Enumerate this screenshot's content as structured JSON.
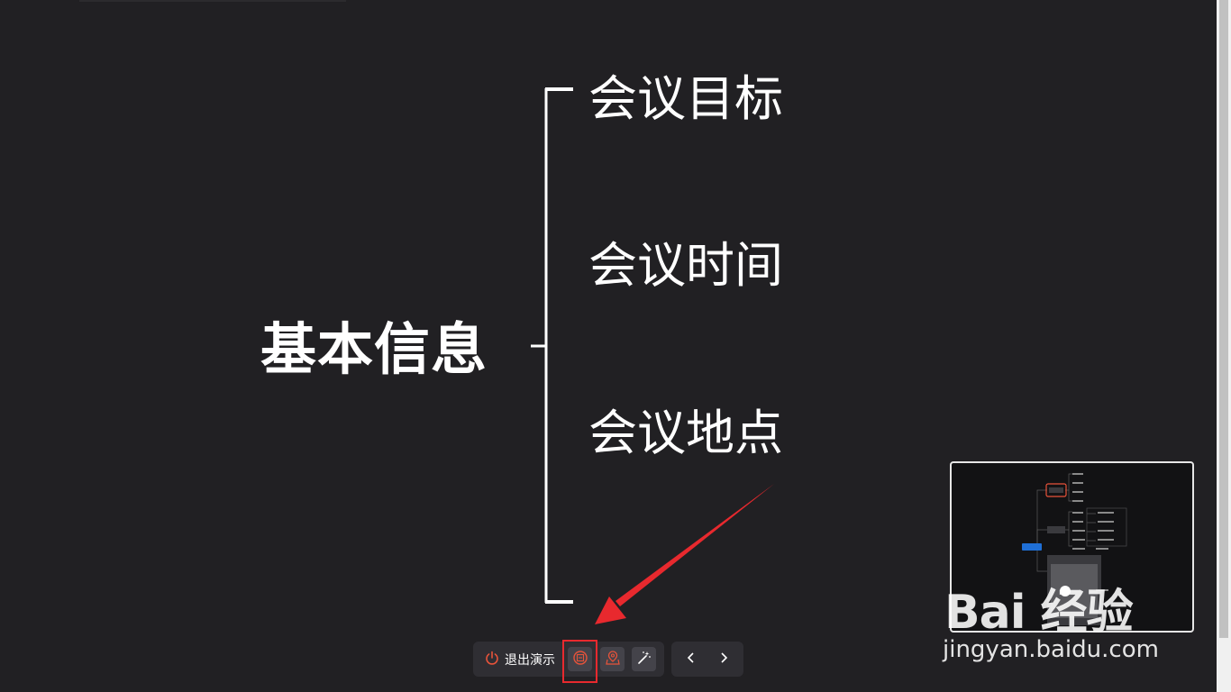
{
  "mindmap": {
    "root": "基本信息",
    "children": [
      "会议目标",
      "会议时间",
      "会议地点"
    ]
  },
  "toolbar": {
    "exit_label": "退出演示",
    "tools": [
      {
        "icon": "stamp-icon",
        "active": true
      },
      {
        "icon": "map-pin-icon",
        "active": false
      },
      {
        "icon": "magic-wand-icon",
        "active": false
      }
    ],
    "nav": [
      {
        "icon": "chevron-left-icon"
      },
      {
        "icon": "chevron-right-icon"
      }
    ]
  },
  "watermark": {
    "logo_text": "Bai 经验",
    "url": "jingyan.baidu.com"
  },
  "colors": {
    "background": "#212023",
    "accent": "#e8533a",
    "annotation_red": "#e8292e",
    "minimap_center_node": "#1f6fd6"
  }
}
